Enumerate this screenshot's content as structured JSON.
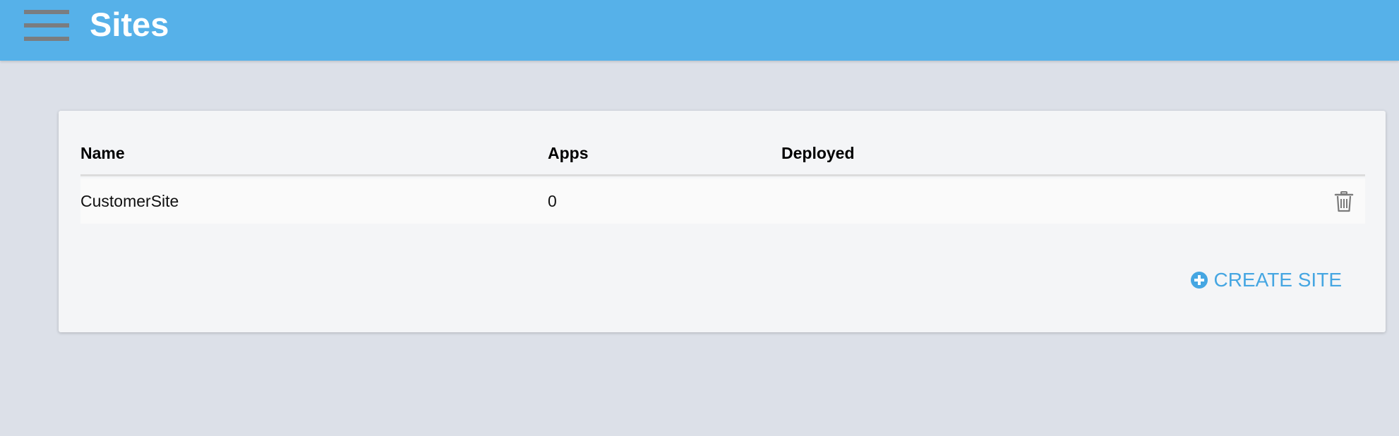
{
  "header": {
    "title": "Sites",
    "menu_icon": "hamburger-menu-icon",
    "color": "#56b1e9"
  },
  "table": {
    "columns": [
      "Name",
      "Apps",
      "Deployed"
    ],
    "rows": [
      {
        "name": "CustomerSite",
        "apps": "0",
        "deployed": "",
        "action_icon": "trash-icon"
      }
    ]
  },
  "actions": {
    "create_label": "CREATE SITE",
    "create_icon": "plus-circle-icon",
    "accent": "#45a6e2"
  }
}
